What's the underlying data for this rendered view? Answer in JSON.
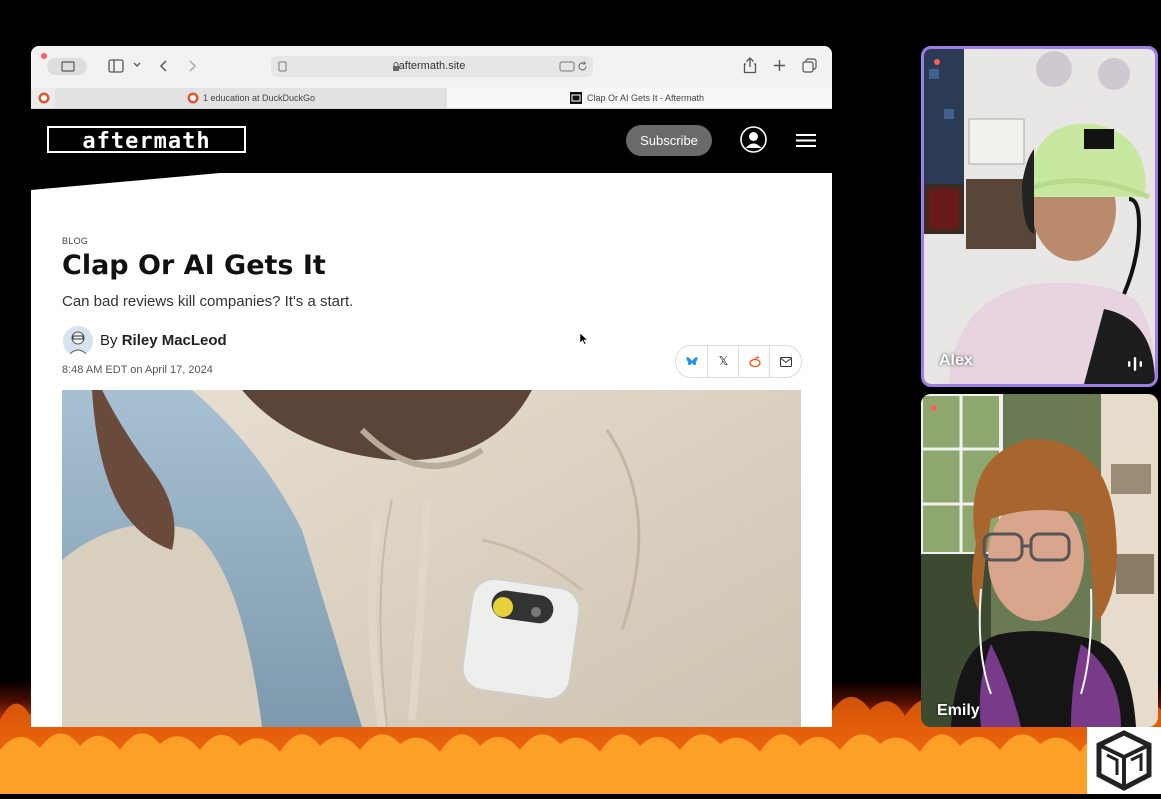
{
  "browser": {
    "address": "aftermath.site",
    "tabs": [
      {
        "label": "1 education at DuckDuckGo"
      },
      {
        "label": "Clap Or AI Gets It - Aftermath"
      }
    ]
  },
  "site": {
    "logo_text": "aftermath",
    "subscribe_label": "Subscribe"
  },
  "article": {
    "kicker": "BLOG",
    "title": "Clap Or AI Gets It",
    "subtitle": "Can bad reviews kill companies? It's a start.",
    "byline_prefix": "By",
    "author": "Riley MacLeod",
    "date": "8:48 AM EDT on April 17, 2024"
  },
  "share": {
    "icons": [
      "bluesky-icon",
      "x-icon",
      "reddit-icon",
      "email-icon"
    ],
    "x_glyph": "𝕏",
    "email_glyph": "✉"
  },
  "participants": [
    {
      "name": "Alex",
      "active_speaker": true
    },
    {
      "name": "Emily",
      "active_speaker": false
    }
  ],
  "colors": {
    "active_speaker_border": "#9d7ee8",
    "site_header_bg": "#000000",
    "subscribe_bg": "#6a6a6a"
  }
}
